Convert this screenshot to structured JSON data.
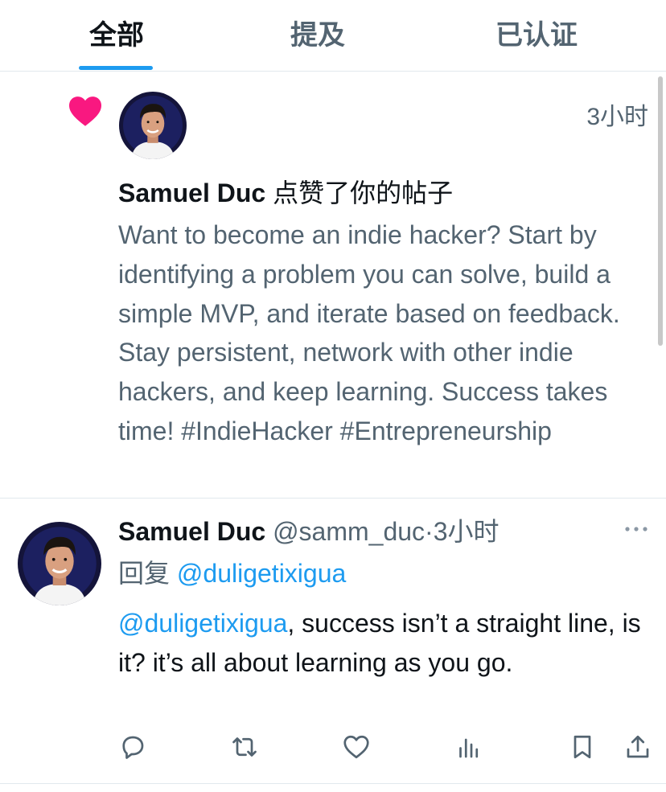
{
  "tabs": [
    {
      "label": "全部",
      "active": true
    },
    {
      "label": "提及",
      "active": false
    },
    {
      "label": "已认证",
      "active": false
    }
  ],
  "notification": {
    "icon": "heart-icon",
    "time": "3小时",
    "user_name": "Samuel Duc",
    "action": " 点赞了你的帖子",
    "post_text": "Want to become an indie hacker? Start by identifying a problem you can solve, build a simple MVP, and iterate based on feedback. Stay persistent, network with other indie hackers, and keep learning. Success takes time! #IndieHacker #Entrepreneurship"
  },
  "reply": {
    "user_name": "Samuel Duc",
    "handle_time": " @samm_duc·3小时",
    "replying_prefix": "回复 ",
    "replying_to": "@duligetixigua",
    "mention": "@duligetixigua",
    "text": ", success isn’t a straight line, is it? it’s all about learning as you go.",
    "actions": [
      "reply-icon",
      "retweet-icon",
      "like-icon",
      "views-icon",
      "bookmark-icon",
      "share-icon"
    ]
  },
  "colors": {
    "accent": "#1d9bf0",
    "heart": "#f91880",
    "secondary_text": "#536471",
    "primary_text": "#0f1419"
  }
}
